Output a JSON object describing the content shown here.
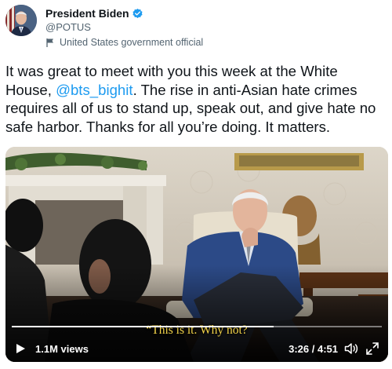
{
  "author": {
    "display_name": "President Biden",
    "handle": "@POTUS",
    "label": "United States government official"
  },
  "tweet": {
    "text_before": "It was great to meet with you this week at the White House, ",
    "mention": "@bts_bighit",
    "text_after": ". The rise in anti-Asian hate crimes requires all of us to stand up, speak out, and give hate no safe harbor. Thanks for all you’re doing. It matters."
  },
  "video": {
    "subtitle": "“This is it. Why not?",
    "views": "1.1M views",
    "time": "3:26 / 4:51",
    "progress": 0.708
  },
  "icons": {
    "verified": "verified-badge-icon",
    "label": "flag-icon",
    "play": "play-icon",
    "volume": "volume-icon",
    "fullscreen": "fullscreen-icon"
  },
  "colors": {
    "link": "#1d9bf0",
    "verified": "#1d9bf0",
    "subtitle": "#f4d54a"
  }
}
